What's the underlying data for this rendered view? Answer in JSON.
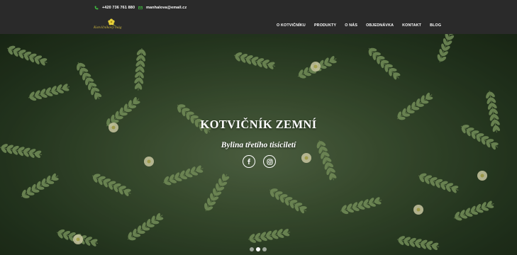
{
  "topbar": {
    "phone": "+420 736 761 880",
    "email": "manhalova@email.cz"
  },
  "logo": {
    "text": "Kotvičníkový mág",
    "icon": "yellow-flower-icon"
  },
  "nav": {
    "items": [
      {
        "label": "O KOTVIČNÍKU"
      },
      {
        "label": "PRODUKTY"
      },
      {
        "label": "O NÁS"
      },
      {
        "label": "OBJEDNÁVKA"
      },
      {
        "label": "KONTAKT"
      },
      {
        "label": "BLOG"
      }
    ]
  },
  "hero": {
    "title": "KOTVIČNÍK ZEMNÍ",
    "subtitle": "Bylina třetího tisíciletí",
    "social": [
      {
        "icon": "facebook-icon"
      },
      {
        "icon": "instagram-icon"
      }
    ],
    "slides": 3,
    "active_slide": 1
  },
  "colors": {
    "topbar_bg": "#2a2a2a",
    "accent_green": "#3fbf3f",
    "logo_gold": "#c7b33d"
  }
}
